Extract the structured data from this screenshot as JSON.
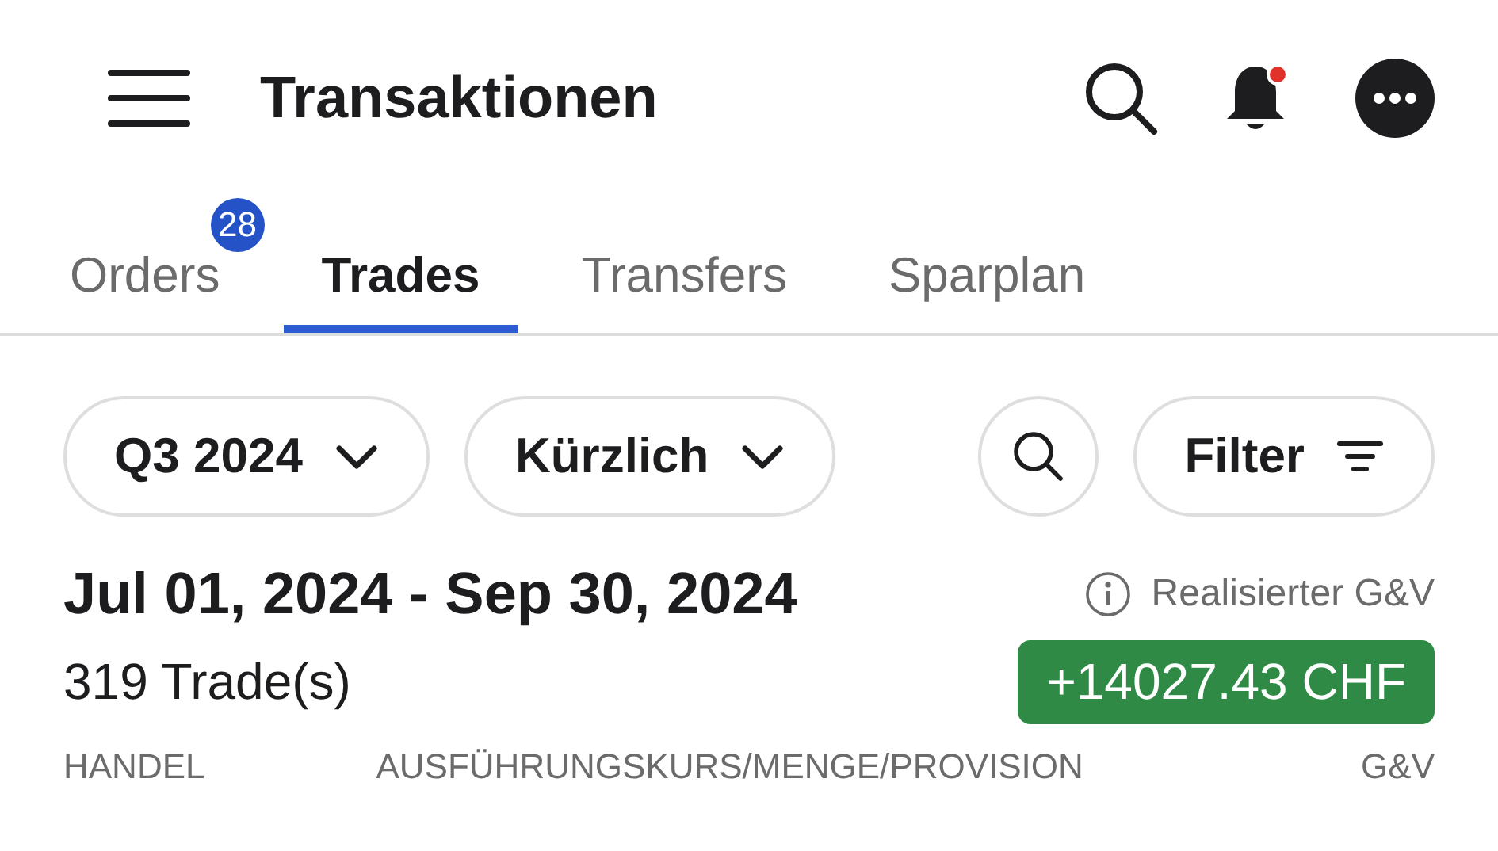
{
  "header": {
    "title": "Transaktionen",
    "notification_dot": true
  },
  "tabs": [
    {
      "label": "Orders",
      "selected": false,
      "badge": "28"
    },
    {
      "label": "Trades",
      "selected": true
    },
    {
      "label": "Transfers",
      "selected": false
    },
    {
      "label": "Sparplan",
      "selected": false
    }
  ],
  "chips": [
    {
      "kind": "dropdown",
      "label": "Q3 2024"
    },
    {
      "kind": "dropdown",
      "label": "Kürzlich"
    },
    {
      "kind": "search"
    },
    {
      "kind": "filter",
      "label": "Filter"
    }
  ],
  "period": {
    "range": "Jul 01, 2024 - Sep 30, 2024",
    "info_label": "Realisierter G&V",
    "trade_count": "319 Trade(s)",
    "pnl": "+14027.43 CHF",
    "pnl_positive": true
  },
  "columns": [
    "HANDEL",
    "AUSFÜHRUNGSKURS/MENGE/PROVISION",
    "G&V"
  ]
}
